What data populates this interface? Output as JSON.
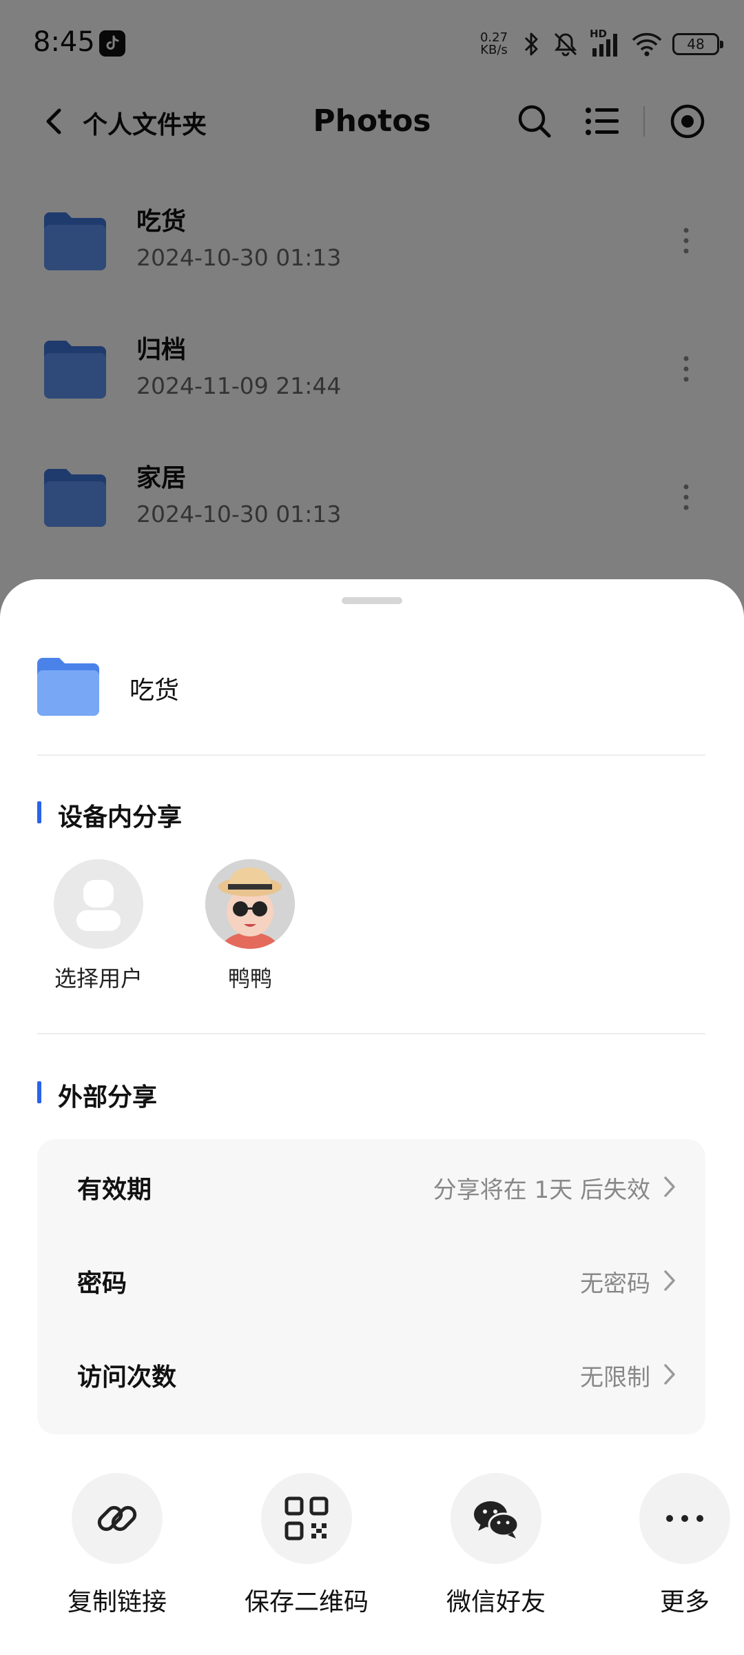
{
  "status_bar": {
    "time": "8:45",
    "net_speed_value": "0.27",
    "net_speed_unit": "KB/s",
    "network_label": "HD",
    "battery": "48"
  },
  "header": {
    "back_label": "个人文件夹",
    "title": "Photos"
  },
  "files": [
    {
      "name": "吃货",
      "date": "2024-10-30 01:13"
    },
    {
      "name": "归档",
      "date": "2024-11-09 21:44"
    },
    {
      "name": "家居",
      "date": "2024-10-30 01:13"
    }
  ],
  "sheet": {
    "folder_name": "吃货",
    "device_share_title": "设备内分享",
    "users": [
      {
        "name": "选择用户"
      },
      {
        "name": "鸭鸭"
      }
    ],
    "external_share_title": "外部分享",
    "settings": [
      {
        "label": "有效期",
        "value": "分享将在 1天 后失效"
      },
      {
        "label": "密码",
        "value": "无密码"
      },
      {
        "label": "访问次数",
        "value": "无限制"
      }
    ],
    "actions": [
      {
        "label": "复制链接",
        "icon": "link-icon"
      },
      {
        "label": "保存二维码",
        "icon": "qr-code-icon"
      },
      {
        "label": "微信好友",
        "icon": "wechat-icon"
      },
      {
        "label": "更多",
        "icon": "more-horizontal-icon"
      }
    ]
  },
  "colors": {
    "accent": "#2a63e6",
    "folder_blue": "#5f95f0",
    "overlay": "rgba(0,0,0,0.5)"
  }
}
